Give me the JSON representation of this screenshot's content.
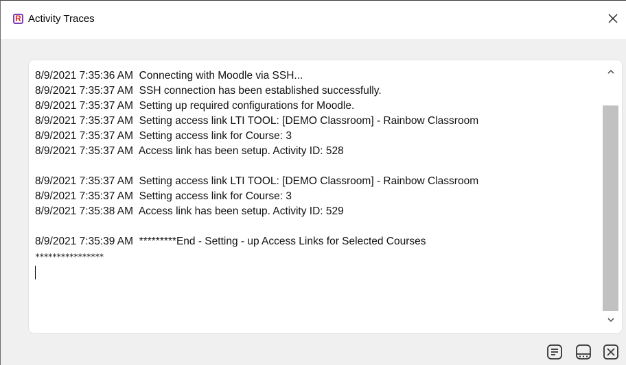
{
  "window": {
    "title": "Activity Traces",
    "app_icon_letter": "R",
    "icons": {
      "app": "rainbow-app-icon",
      "close": "close-icon",
      "scroll_up": "chevron-up-icon",
      "scroll_down": "chevron-down-icon",
      "doc": "document-icon",
      "minimize_panel": "window-minimize-icon",
      "close_panel": "close-box-icon"
    }
  },
  "log": {
    "lines": [
      "8/9/2021 7:35:36 AM  Connecting with Moodle via SSH...",
      "8/9/2021 7:35:37 AM  SSH connection has been established successfully.",
      "8/9/2021 7:35:37 AM  Setting up required configurations for Moodle.",
      "8/9/2021 7:35:37 AM  Setting access link LTI TOOL: [DEMO Classroom] - Rainbow Classroom",
      "8/9/2021 7:35:37 AM  Setting access link for Course: 3",
      "8/9/2021 7:35:37 AM  Access link has been setup. Activity ID: 528",
      "",
      "8/9/2021 7:35:37 AM  Setting access link LTI TOOL: [DEMO Classroom] - Rainbow Classroom",
      "8/9/2021 7:35:37 AM  Setting access link for Course: 3",
      "8/9/2021 7:35:38 AM  Access link has been setup. Activity ID: 529",
      "",
      "8/9/2021 7:35:39 AM  *********End - Setting - up Access Links for Selected Courses"
    ],
    "trailing_stars": "****************"
  },
  "colors": {
    "accent": "#7b3fb8",
    "icon_red": "#e2231a",
    "scroll_thumb": "#c1c1c1"
  }
}
